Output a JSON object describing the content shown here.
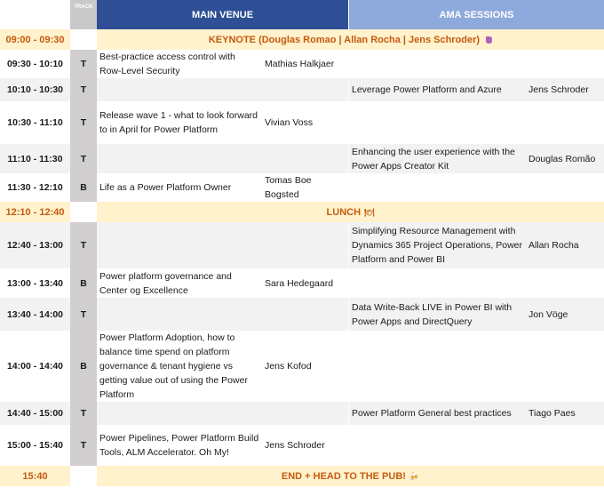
{
  "header": {
    "track_label": "TRACK",
    "main_label": "MAIN VENUE",
    "ama_label": "AMA SESSIONS"
  },
  "keynote": {
    "time": "09:00 - 09:30",
    "title": "KEYNOTE (Douglas Romao | Allan Rocha | Jens Schroder)"
  },
  "lunch": {
    "time": "12:10 - 12:40",
    "title": "LUNCH",
    "icon": "🍽"
  },
  "end": {
    "time": "15:40",
    "title": "END + HEAD TO THE PUB!",
    "icon": "🍻"
  },
  "sessions": [
    {
      "time": "09:30 - 10:10",
      "track": "T",
      "main_title": "Best-practice access control with Row-Level Security",
      "main_speaker": "Mathias Halkjaer",
      "ama_title": "",
      "ama_speaker": ""
    },
    {
      "time": "10:10 - 10:30",
      "track": "T",
      "main_title": "",
      "main_speaker": "",
      "ama_title": "Leverage Power Platform and Azure",
      "ama_speaker": "Jens Schroder"
    },
    {
      "time": "10:30 - 11:10",
      "track": "T",
      "main_title": "Release wave 1 - what to look forward to in April for Power Platform",
      "main_speaker": "Vivian Voss",
      "ama_title": "",
      "ama_speaker": ""
    },
    {
      "time": "11:10 - 11:30",
      "track": "T",
      "main_title": "",
      "main_speaker": "",
      "ama_title": "Enhancing the user experience with the Power Apps Creator Kit",
      "ama_speaker": "Douglas Romão"
    },
    {
      "time": "11:30 - 12:10",
      "track": "B",
      "main_title": "Life as a Power Platform Owner",
      "main_speaker": "Tomas Boe Bogsted",
      "ama_title": "",
      "ama_speaker": ""
    },
    {
      "time": "12:40 - 13:00",
      "track": "T",
      "main_title": "",
      "main_speaker": "",
      "ama_title": "Simplifying Resource Management with Dynamics 365 Project Operations, Power Platform and Power BI",
      "ama_speaker": "Allan Rocha"
    },
    {
      "time": "13:00 - 13:40",
      "track": "B",
      "main_title": "Power platform governance and Center og Excellence",
      "main_speaker": "Sara Hedegaard",
      "ama_title": "",
      "ama_speaker": ""
    },
    {
      "time": "13:40 - 14:00",
      "track": "T",
      "main_title": "",
      "main_speaker": "",
      "ama_title": "Data Write-Back LIVE in Power BI with Power Apps and DirectQuery",
      "ama_speaker": "Jon Vöge"
    },
    {
      "time": "14:00 - 14:40",
      "track": "B",
      "main_title": "Power Platform Adoption, how to balance time spend on platform governance & tenant hygiene vs getting value out of using the Power Platform",
      "main_speaker": "Jens Kofod",
      "ama_title": "",
      "ama_speaker": ""
    },
    {
      "time": "14:40 - 15:00",
      "track": "T",
      "main_title": "",
      "main_speaker": "",
      "ama_title": "Power Platform General best practices",
      "ama_speaker": "Tiago Paes"
    },
    {
      "time": "15:00 - 15:40",
      "track": "T",
      "main_title": "Power Pipelines, Power Platform Build Tools, ALM Accelerator. Oh My!",
      "main_speaker": "Jens Schroder",
      "ama_title": "",
      "ama_speaker": ""
    }
  ]
}
